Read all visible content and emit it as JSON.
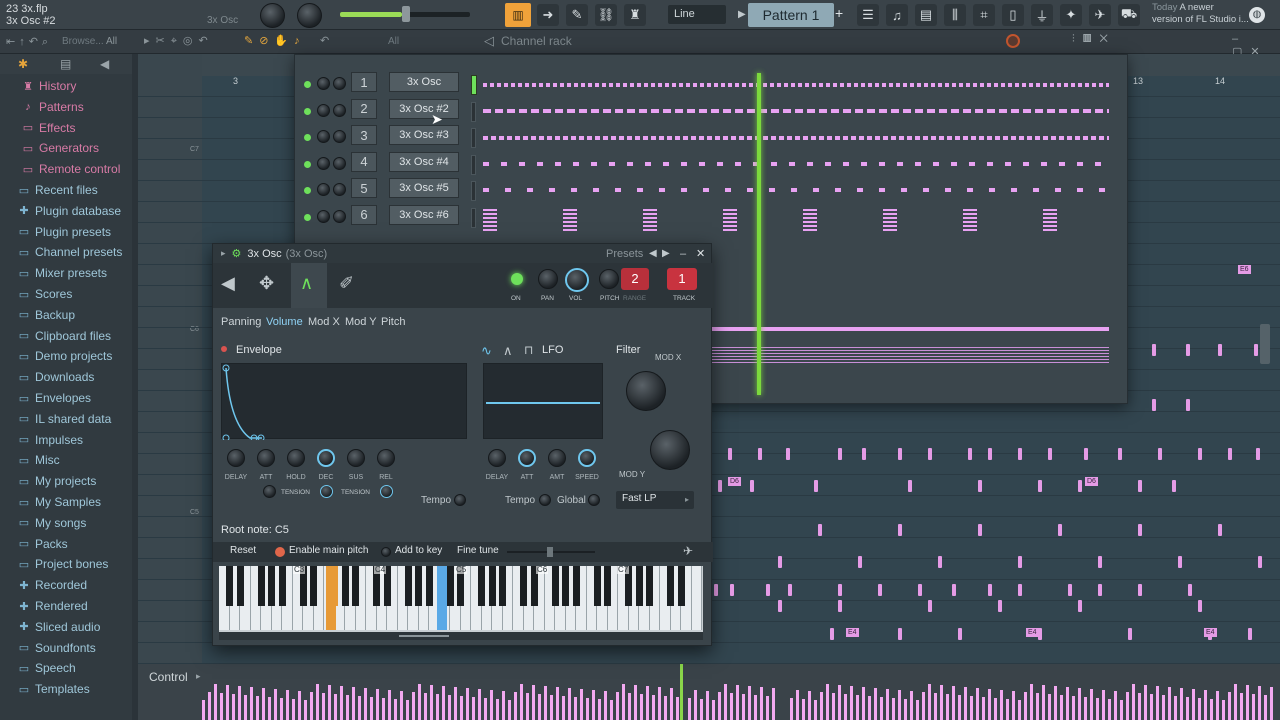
{
  "app": {
    "file_name": "23 3x.flp",
    "focused_channel": "3x Osc #2",
    "hint_mini": "3x Osc",
    "snap_mode": "Line",
    "pattern_name": "Pattern 1",
    "news_line1": "Today",
    "news_line2": "A newer",
    "news_line3": "version of FL Studio i..."
  },
  "browser": {
    "search_placeholder": "Browse...",
    "filter": "All",
    "items": [
      {
        "label": "History",
        "icon": "history"
      },
      {
        "label": "Patterns",
        "icon": "note"
      },
      {
        "label": "Effects",
        "icon": "folder"
      },
      {
        "label": "Generators",
        "icon": "folder"
      },
      {
        "label": "Remote control",
        "icon": "folder"
      },
      {
        "label": "Recent files",
        "icon": "folder"
      },
      {
        "label": "Plugin database",
        "icon": "plugin"
      },
      {
        "label": "Plugin presets",
        "icon": "folder"
      },
      {
        "label": "Channel presets",
        "icon": "folder"
      },
      {
        "label": "Mixer presets",
        "icon": "folder"
      },
      {
        "label": "Scores",
        "icon": "folder"
      },
      {
        "label": "Backup",
        "icon": "folder"
      },
      {
        "label": "Clipboard files",
        "icon": "folder"
      },
      {
        "label": "Demo projects",
        "icon": "folder"
      },
      {
        "label": "Downloads",
        "icon": "folder"
      },
      {
        "label": "Envelopes",
        "icon": "folder"
      },
      {
        "label": "IL shared data",
        "icon": "folder"
      },
      {
        "label": "Impulses",
        "icon": "folder"
      },
      {
        "label": "Misc",
        "icon": "folder"
      },
      {
        "label": "My projects",
        "icon": "folder"
      },
      {
        "label": "My Samples",
        "icon": "folder"
      },
      {
        "label": "My songs",
        "icon": "folder"
      },
      {
        "label": "Packs",
        "icon": "folder"
      },
      {
        "label": "Project bones",
        "icon": "folder"
      },
      {
        "label": "Recorded",
        "icon": "plus"
      },
      {
        "label": "Rendered",
        "icon": "plus"
      },
      {
        "label": "Sliced audio",
        "icon": "plus"
      },
      {
        "label": "Soundfonts",
        "icon": "folder"
      },
      {
        "label": "Speech",
        "icon": "folder"
      },
      {
        "label": "Templates",
        "icon": "folder"
      }
    ]
  },
  "channel_rack": {
    "title": "Channel rack",
    "filter": "All",
    "channels": [
      {
        "num": "1",
        "name": "3x Osc"
      },
      {
        "num": "2",
        "name": "3x Osc #2"
      },
      {
        "num": "3",
        "name": "3x Osc #3"
      },
      {
        "num": "4",
        "name": "3x Osc #4"
      },
      {
        "num": "5",
        "name": "3x Osc #5"
      },
      {
        "num": "6",
        "name": "3x Osc #6"
      }
    ]
  },
  "playlist": {
    "bar_3": "3",
    "bar_13": "13",
    "bar_14": "14",
    "note_c7": "C7",
    "note_c6": "C6",
    "note_c5": "C5",
    "clip_e6": "E6",
    "clip_d6a": "D6",
    "clip_d6b": "D6",
    "clip_e4a": "E4",
    "clip_e4b": "E4",
    "clip_e4c": "E4"
  },
  "plugin": {
    "title": "3x Osc",
    "subtitle": "(3x Osc)",
    "presets": "Presets",
    "knob_labels": {
      "on": "ON",
      "pan": "PAN",
      "vol": "VOL",
      "pitch": "PITCH",
      "range": "RANGE",
      "track": "TRACK"
    },
    "range_value": "2",
    "track_value": "1",
    "tabs": [
      "Panning",
      "Volume",
      "Mod X",
      "Mod Y",
      "Pitch"
    ],
    "active_tab": "Volume",
    "envelope_label": "Envelope",
    "env_knobs": [
      "DELAY",
      "ATT",
      "HOLD",
      "DEC",
      "SUS",
      "REL"
    ],
    "tension_label": "TENSION",
    "tempo": "Tempo",
    "lfo_label": "LFO",
    "lfo_knobs": [
      "DELAY",
      "ATT",
      "AMT",
      "SPEED"
    ],
    "global": "Global",
    "filter_label": "Filter",
    "mod_x": "MOD X",
    "mod_y": "MOD Y",
    "filter_type": "Fast LP",
    "root_note": "Root note: C5",
    "reset": "Reset",
    "enable_main_pitch": "Enable main pitch",
    "add_to_key": "Add to key",
    "fine_tune": "Fine tune",
    "octave_labels": [
      "C3",
      "C4",
      "C5",
      "C6",
      "C7"
    ]
  },
  "control": {
    "label": "Control"
  },
  "colors": {
    "accent_pink": "#e59be6",
    "accent_blue": "#8fd2f4",
    "led_green": "#6ee05b",
    "track_red": "#c8333f"
  }
}
